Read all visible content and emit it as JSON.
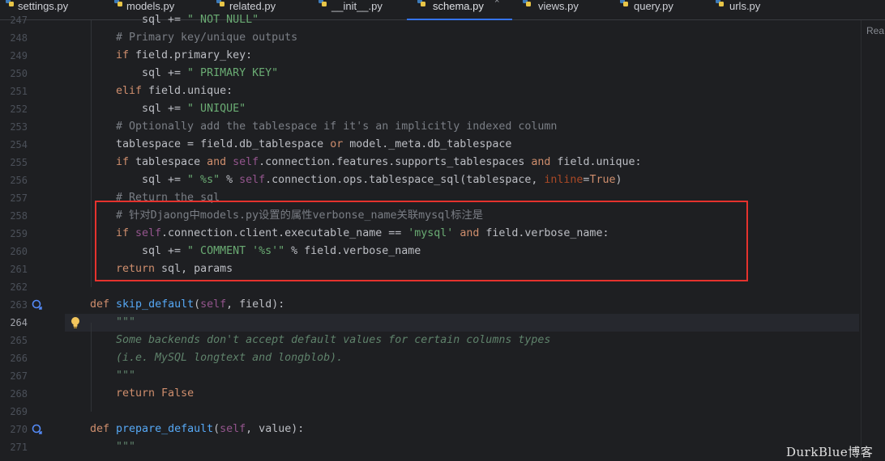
{
  "tabs": [
    {
      "label": "settings.py",
      "active": false
    },
    {
      "label": "models.py",
      "active": false
    },
    {
      "label": "related.py",
      "active": false
    },
    {
      "label": "__init__.py",
      "active": false
    },
    {
      "label": "schema.py",
      "active": true
    },
    {
      "label": "views.py",
      "active": false
    },
    {
      "label": "query.py",
      "active": false
    },
    {
      "label": "urls.py",
      "active": false
    }
  ],
  "close_glyph": "×",
  "reader_mode_label": "Rea",
  "watermark": "DurkBlue博客",
  "current_line": "264",
  "code": {
    "l247": {
      "n": "247",
      "a": "sql += ",
      "b": "\" NOT NULL\""
    },
    "l248": {
      "n": "248",
      "t": "# Primary key/unique outputs"
    },
    "l249": {
      "n": "249",
      "k": "if",
      "t": " field.primary_key:"
    },
    "l250": {
      "n": "250",
      "a": "sql += ",
      "s": "\" PRIMARY KEY\""
    },
    "l251": {
      "n": "251",
      "k": "elif",
      "t": " field.unique:"
    },
    "l252": {
      "n": "252",
      "a": "sql += ",
      "s": "\" UNIQUE\""
    },
    "l253": {
      "n": "253",
      "t": "# Optionally add the tablespace if it's an implicitly indexed column"
    },
    "l254": {
      "n": "254",
      "a": "tablespace = field.db_tablespace ",
      "k": "or",
      "b": " model._meta.db_tablespace"
    },
    "l255": {
      "n": "255",
      "k": "if",
      "a": " tablespace ",
      "k2": "and",
      "self": " self",
      "b": ".connection.features.supports_tablespaces ",
      "k3": "and",
      "c": " field.unique:"
    },
    "l256": {
      "n": "256",
      "a": "sql += ",
      "s": "\" %s\"",
      "b": " % ",
      "self": "self",
      "c": ".connection.ops.tablespace_sql(tablespace, ",
      "kw": "inline",
      "d": "=",
      "k": "True",
      "e": ")"
    },
    "l257": {
      "n": "257",
      "t": "# Return the sql"
    },
    "l258": {
      "n": "258",
      "t": "# 针对Djaong中models.py设置的属性verbonse_name关联mysql标注是"
    },
    "l259": {
      "n": "259",
      "k": "if",
      "self": " self",
      "a": ".connection.client.executable_name == ",
      "s": "'mysql'",
      "k2": " and",
      "b": " field.verbose_name:"
    },
    "l260": {
      "n": "260",
      "a": "sql += ",
      "s": "\" COMMENT '%s'\"",
      "b": " % field.verbose_name"
    },
    "l261": {
      "n": "261",
      "k": "return",
      "t": " sql, params"
    },
    "l262": {
      "n": "262"
    },
    "l263": {
      "n": "263",
      "k": "def",
      "fn": " skip_default",
      "a": "(",
      "self": "self",
      "b": ", field):"
    },
    "l264": {
      "n": "264",
      "doc": "\"\"\""
    },
    "l265": {
      "n": "265",
      "doc": "Some backends don't accept default values for certain columns types"
    },
    "l266": {
      "n": "266",
      "doc": "(i.e. MySQL longtext and longblob)."
    },
    "l267": {
      "n": "267",
      "doc": "\"\"\""
    },
    "l268": {
      "n": "268",
      "k": "return",
      "k2": " False"
    },
    "l269": {
      "n": "269"
    },
    "l270": {
      "n": "270",
      "k": "def",
      "fn": " prepare_default",
      "a": "(",
      "self": "self",
      "b": ", value):"
    },
    "l271": {
      "n": "271",
      "doc": "\"\"\""
    }
  },
  "colors": {
    "background": "#1e1f22",
    "keyword": "#cf8e6d",
    "string": "#6aab73",
    "comment": "#7a7e85",
    "function": "#56a8f5",
    "self": "#94558d",
    "docstring": "#5f826b",
    "highlight_box": "#e5322d",
    "active_tab_underline": "#3574f0"
  },
  "icons": {
    "file_type": "python-file-icon",
    "override": "override-method-icon",
    "hint": "lightbulb-icon"
  }
}
